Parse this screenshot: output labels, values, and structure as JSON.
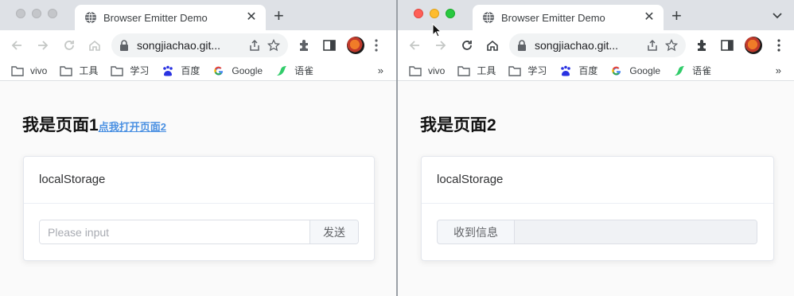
{
  "left_window": {
    "tab": {
      "title": "Browser Emitter Demo",
      "close": "✕",
      "favicon": "globe-icon"
    },
    "new_tab": "+",
    "url": "songjiachao.git...",
    "bookmarks": [
      {
        "label": "vivo",
        "icon": "folder-icon"
      },
      {
        "label": "工具",
        "icon": "folder-icon"
      },
      {
        "label": "学习",
        "icon": "folder-icon"
      },
      {
        "label": "百度",
        "icon": "baidu-icon"
      },
      {
        "label": "Google",
        "icon": "google-icon"
      },
      {
        "label": "语雀",
        "icon": "yuque-icon"
      }
    ],
    "bookmarks_more": "»",
    "page": {
      "heading": "我是页面1",
      "link": "点我打开页面2",
      "card_title": "localStorage",
      "input_placeholder": "Please input",
      "input_value": "",
      "send_button": "发送"
    }
  },
  "right_window": {
    "tab": {
      "title": "Browser Emitter Demo",
      "close": "✕",
      "favicon": "globe-icon"
    },
    "new_tab": "+",
    "url": "songjiachao.git...",
    "bookmarks": [
      {
        "label": "vivo",
        "icon": "folder-icon"
      },
      {
        "label": "工具",
        "icon": "folder-icon"
      },
      {
        "label": "学习",
        "icon": "folder-icon"
      },
      {
        "label": "百度",
        "icon": "baidu-icon"
      },
      {
        "label": "Google",
        "icon": "google-icon"
      },
      {
        "label": "语雀",
        "icon": "yuque-icon"
      }
    ],
    "bookmarks_more": "»",
    "page": {
      "heading": "我是页面2",
      "card_title": "localStorage",
      "received_label": "收到信息",
      "received_value": ""
    }
  },
  "colors": {
    "tabstrip": "#dee1e6",
    "link": "#4a90e2",
    "traffic_red": "#ff5f57",
    "traffic_yellow": "#febc2e",
    "traffic_green": "#28c840",
    "traffic_inactive": "#c4c6ca"
  }
}
